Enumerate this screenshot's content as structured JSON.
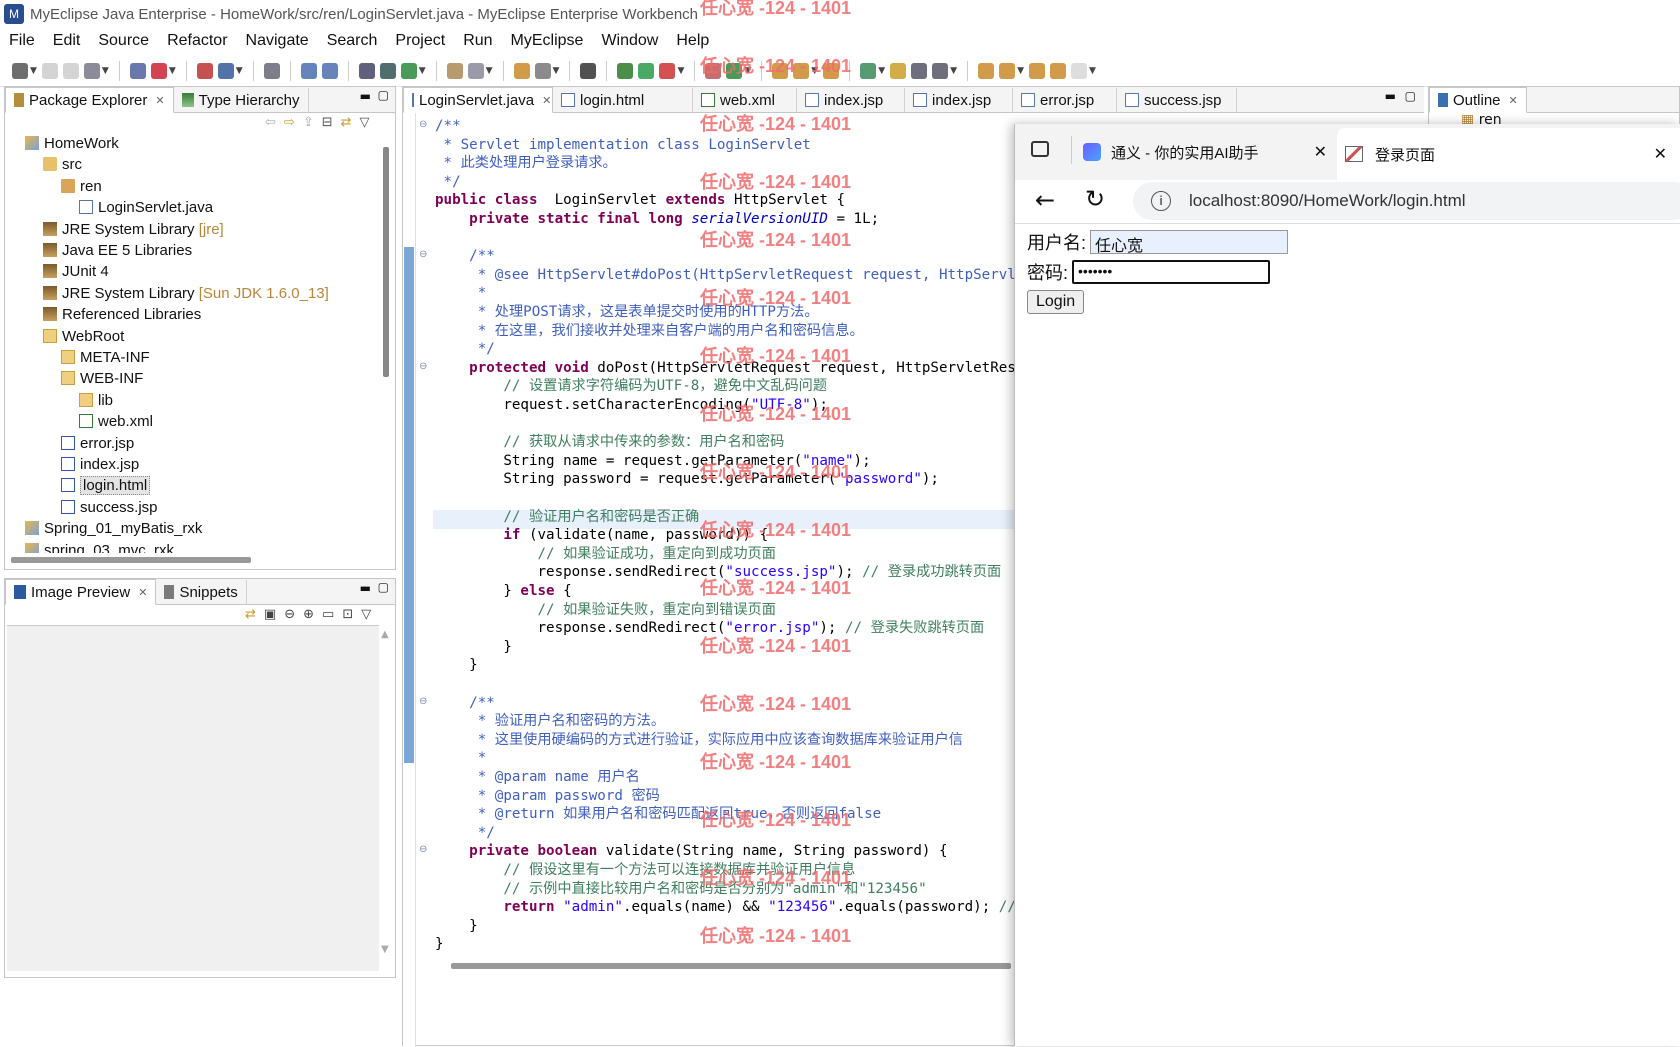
{
  "window": {
    "title": "MyEclipse Java Enterprise - HomeWork/src/ren/LoginServlet.java - MyEclipse Enterprise Workbench"
  },
  "menu": [
    "File",
    "Edit",
    "Source",
    "Refactor",
    "Navigate",
    "Search",
    "Project",
    "Run",
    "MyEclipse",
    "Window",
    "Help"
  ],
  "left_top": {
    "tabs": [
      "Package Explorer",
      "Type Hierarchy"
    ]
  },
  "tree": [
    {
      "label": "HomeWork",
      "extra": "",
      "indent": 0,
      "icon": "project-icon"
    },
    {
      "label": "src",
      "extra": "",
      "indent": 1,
      "icon": "source-folder-icon"
    },
    {
      "label": "ren",
      "extra": "",
      "indent": 2,
      "icon": "package-icon"
    },
    {
      "label": "LoginServlet.java",
      "extra": "",
      "indent": 3,
      "icon": "java-file-icon"
    },
    {
      "label": "JRE System Library",
      "extra": "[jre]",
      "indent": 1,
      "icon": "library-icon"
    },
    {
      "label": "Java EE 5 Libraries",
      "extra": "",
      "indent": 1,
      "icon": "library-icon"
    },
    {
      "label": "JUnit 4",
      "extra": "",
      "indent": 1,
      "icon": "library-icon"
    },
    {
      "label": "JRE System Library",
      "extra": "[Sun JDK 1.6.0_13]",
      "indent": 1,
      "icon": "library-icon"
    },
    {
      "label": "Referenced Libraries",
      "extra": "",
      "indent": 1,
      "icon": "library-icon"
    },
    {
      "label": "WebRoot",
      "extra": "",
      "indent": 1,
      "icon": "folder-icon"
    },
    {
      "label": "META-INF",
      "extra": "",
      "indent": 2,
      "icon": "folder-icon"
    },
    {
      "label": "WEB-INF",
      "extra": "",
      "indent": 2,
      "icon": "folder-icon"
    },
    {
      "label": "lib",
      "extra": "",
      "indent": 3,
      "icon": "folder-icon"
    },
    {
      "label": "web.xml",
      "extra": "",
      "indent": 3,
      "icon": "xml-file-icon"
    },
    {
      "label": "error.jsp",
      "extra": "",
      "indent": 2,
      "icon": "jsp-file-icon"
    },
    {
      "label": "index.jsp",
      "extra": "",
      "indent": 2,
      "icon": "jsp-file-icon"
    },
    {
      "label": "login.html",
      "extra": "",
      "indent": 2,
      "icon": "html-file-icon",
      "selected": true
    },
    {
      "label": "success.jsp",
      "extra": "",
      "indent": 2,
      "icon": "jsp-file-icon"
    },
    {
      "label": "Spring_01_myBatis_rxk",
      "extra": "",
      "indent": 0,
      "icon": "project-icon"
    },
    {
      "label": "spring_03_mvc_rxk",
      "extra": "",
      "indent": 0,
      "icon": "project-icon"
    }
  ],
  "left_bottom": {
    "tabs": [
      "Image Preview",
      "Snippets"
    ]
  },
  "editor_tabs": [
    "LoginServlet.java",
    "login.html",
    "web.xml",
    "index.jsp",
    "index.jsp",
    "error.jsp",
    "success.jsp"
  ],
  "outline": {
    "tab": "Outline",
    "item": "ren"
  },
  "code": [
    [
      [
        "jd",
        "/**"
      ]
    ],
    [
      [
        "jd",
        " * Servlet implementation class LoginServlet"
      ]
    ],
    [
      [
        "jd",
        " * 此类处理用户登录请求。"
      ]
    ],
    [
      [
        "jd",
        " */"
      ]
    ],
    [
      [
        "kw",
        "public class"
      ],
      [
        "",
        "  LoginServlet "
      ],
      [
        "kw",
        "extends"
      ],
      [
        "",
        " HttpServlet {"
      ]
    ],
    [
      [
        "",
        "    "
      ],
      [
        "kw",
        "private static final long"
      ],
      [
        "",
        " "
      ],
      [
        "it",
        "serialVersionUID"
      ],
      [
        "",
        " = 1L;"
      ]
    ],
    [
      [
        "",
        ""
      ]
    ],
    [
      [
        "jd",
        "    /**"
      ]
    ],
    [
      [
        "jd",
        "     * @see HttpServlet#doPost(HttpServletRequest request, HttpServle"
      ]
    ],
    [
      [
        "jd",
        "     *"
      ]
    ],
    [
      [
        "jd",
        "     * 处理POST请求，这是表单提交时使用的HTTP方法。"
      ]
    ],
    [
      [
        "jd",
        "     * 在这里，我们接收并处理来自客户端的用户名和密码信息。"
      ]
    ],
    [
      [
        "jd",
        "     */"
      ]
    ],
    [
      [
        "",
        "    "
      ],
      [
        "kw",
        "protected void"
      ],
      [
        "",
        " doPost(HttpServletRequest request, HttpServletResp"
      ]
    ],
    [
      [
        "cm",
        "        // 设置请求字符编码为UTF-8，避免中文乱码问题"
      ]
    ],
    [
      [
        "",
        "        request.setCharacterEncoding("
      ],
      [
        "st",
        "\"UTF-8\""
      ],
      [
        "",
        ");"
      ]
    ],
    [
      [
        "",
        ""
      ]
    ],
    [
      [
        "cm",
        "        // 获取从请求中传来的参数：用户名和密码"
      ]
    ],
    [
      [
        "",
        "        String name = request.getParameter("
      ],
      [
        "st",
        "\"name\""
      ],
      [
        "",
        ");"
      ]
    ],
    [
      [
        "",
        "        String password = request.getParameter("
      ],
      [
        "st",
        "\"password\""
      ],
      [
        "",
        ");"
      ]
    ],
    [
      [
        "",
        ""
      ]
    ],
    [
      [
        "cm",
        "        // 验证用户名和密码是否正确"
      ]
    ],
    [
      [
        "",
        "        "
      ],
      [
        "kw",
        "if"
      ],
      [
        "",
        " (validate(name, password)) {"
      ]
    ],
    [
      [
        "cm",
        "            // 如果验证成功，重定向到成功页面"
      ]
    ],
    [
      [
        "",
        "            response.sendRedirect("
      ],
      [
        "st",
        "\"success.jsp\""
      ],
      [
        "",
        "); "
      ],
      [
        "cm",
        "// 登录成功跳转页面"
      ]
    ],
    [
      [
        "",
        "        } "
      ],
      [
        "kw",
        "else"
      ],
      [
        "",
        " {"
      ]
    ],
    [
      [
        "cm",
        "            // 如果验证失败，重定向到错误页面"
      ]
    ],
    [
      [
        "",
        "            response.sendRedirect("
      ],
      [
        "st",
        "\"error.jsp\""
      ],
      [
        "",
        "); "
      ],
      [
        "cm",
        "// 登录失败跳转页面"
      ]
    ],
    [
      [
        "",
        "        }"
      ]
    ],
    [
      [
        "",
        "    }"
      ]
    ],
    [
      [
        "",
        ""
      ]
    ],
    [
      [
        "jd",
        "    /**"
      ]
    ],
    [
      [
        "jd",
        "     * 验证用户名和密码的方法。"
      ]
    ],
    [
      [
        "jd",
        "     * 这里使用硬编码的方式进行验证，实际应用中应该查询数据库来验证用户信"
      ]
    ],
    [
      [
        "jd",
        "     *"
      ]
    ],
    [
      [
        "jd",
        "     * @param name 用户名"
      ]
    ],
    [
      [
        "jd",
        "     * @param password 密码"
      ]
    ],
    [
      [
        "jd",
        "     * @return 如果用户名和密码匹配返回true，否则返回false"
      ]
    ],
    [
      [
        "jd",
        "     */"
      ]
    ],
    [
      [
        "",
        "    "
      ],
      [
        "kw",
        "private boolean"
      ],
      [
        "",
        " validate(String name, String password) {"
      ]
    ],
    [
      [
        "cm",
        "        // 假设这里有一个方法可以连接数据库并验证用户信息"
      ]
    ],
    [
      [
        "cm",
        "        // 示例中直接比较用户名和密码是否分别为\"admin\"和\"123456\""
      ]
    ],
    [
      [
        "",
        "        "
      ],
      [
        "kw",
        "return"
      ],
      [
        "",
        " "
      ],
      [
        "st",
        "\"admin\""
      ],
      [
        "",
        ".equals(name) && "
      ],
      [
        "st",
        "\"123456\""
      ],
      [
        "",
        ".equals(password); "
      ],
      [
        "cm",
        "//"
      ]
    ],
    [
      [
        "",
        "    }"
      ]
    ],
    [
      [
        "",
        "}"
      ]
    ]
  ],
  "watermark": "任心宽 -124 - 1401",
  "browser": {
    "tab1": "通义 - 你的实用AI助手",
    "tab2": "登录页面",
    "url": "localhost:8090/HomeWork/login.html",
    "form": {
      "username_label": "用户名:",
      "username_value": "任心宽",
      "password_label": "密码:",
      "password_value": "•••••••",
      "login_button": "Login"
    }
  }
}
